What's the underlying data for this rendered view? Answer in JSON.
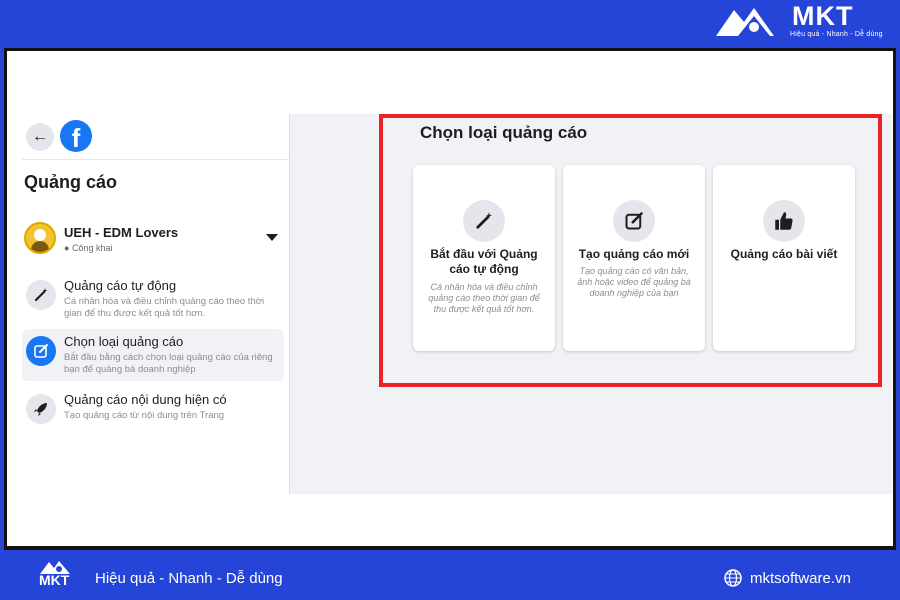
{
  "header": {
    "brand": "MKT",
    "tagline": "Hiệu quả - Nhanh - Dễ dùng"
  },
  "sidebar": {
    "title": "Quảng cáo",
    "page": {
      "name": "UEH - EDM Lovers",
      "visibility": "Công khai"
    },
    "items": [
      {
        "label": "Quảng cáo tự động",
        "desc": "Cá nhân hóa và điều chỉnh quảng cáo theo thời gian để thu được kết quả tốt hơn.",
        "icon": "magic-wand-icon",
        "active": false
      },
      {
        "label": "Chọn loại quảng cáo",
        "desc": "Bắt đầu bằng cách chọn loại quảng cáo của riêng bạn để quảng bá doanh nghiệp",
        "icon": "edit-icon",
        "active": true
      },
      {
        "label": "Quảng cáo nội dung hiện có",
        "desc": "Tạo quảng cáo từ nội dung trên Trang",
        "icon": "rocket-icon",
        "active": false
      }
    ]
  },
  "main": {
    "title": "Chọn loại quảng cáo",
    "cards": [
      {
        "title": "Bắt đầu với Quảng cáo tự động",
        "desc": "Cá nhân hóa và điều chỉnh quảng cáo theo thời gian để thu được kết quả tốt hơn.",
        "icon": "magic-wand-icon"
      },
      {
        "title": "Tạo quảng cáo mới",
        "desc": "Tạo quảng cáo có văn bản, ảnh hoặc video để quảng bá doanh nghiệp của bạn",
        "icon": "edit-icon"
      },
      {
        "title": "Quảng cáo bài viết",
        "desc": "",
        "icon": "thumbs-up-icon"
      }
    ]
  },
  "footer": {
    "brand": "MKT",
    "slogan": "Hiệu quả - Nhanh - Dễ dùng",
    "url": "mktsoftware.vn"
  },
  "colors": {
    "brand_blue": "#2544d8",
    "facebook_blue": "#1877f2",
    "highlight_red": "#e8232a"
  }
}
